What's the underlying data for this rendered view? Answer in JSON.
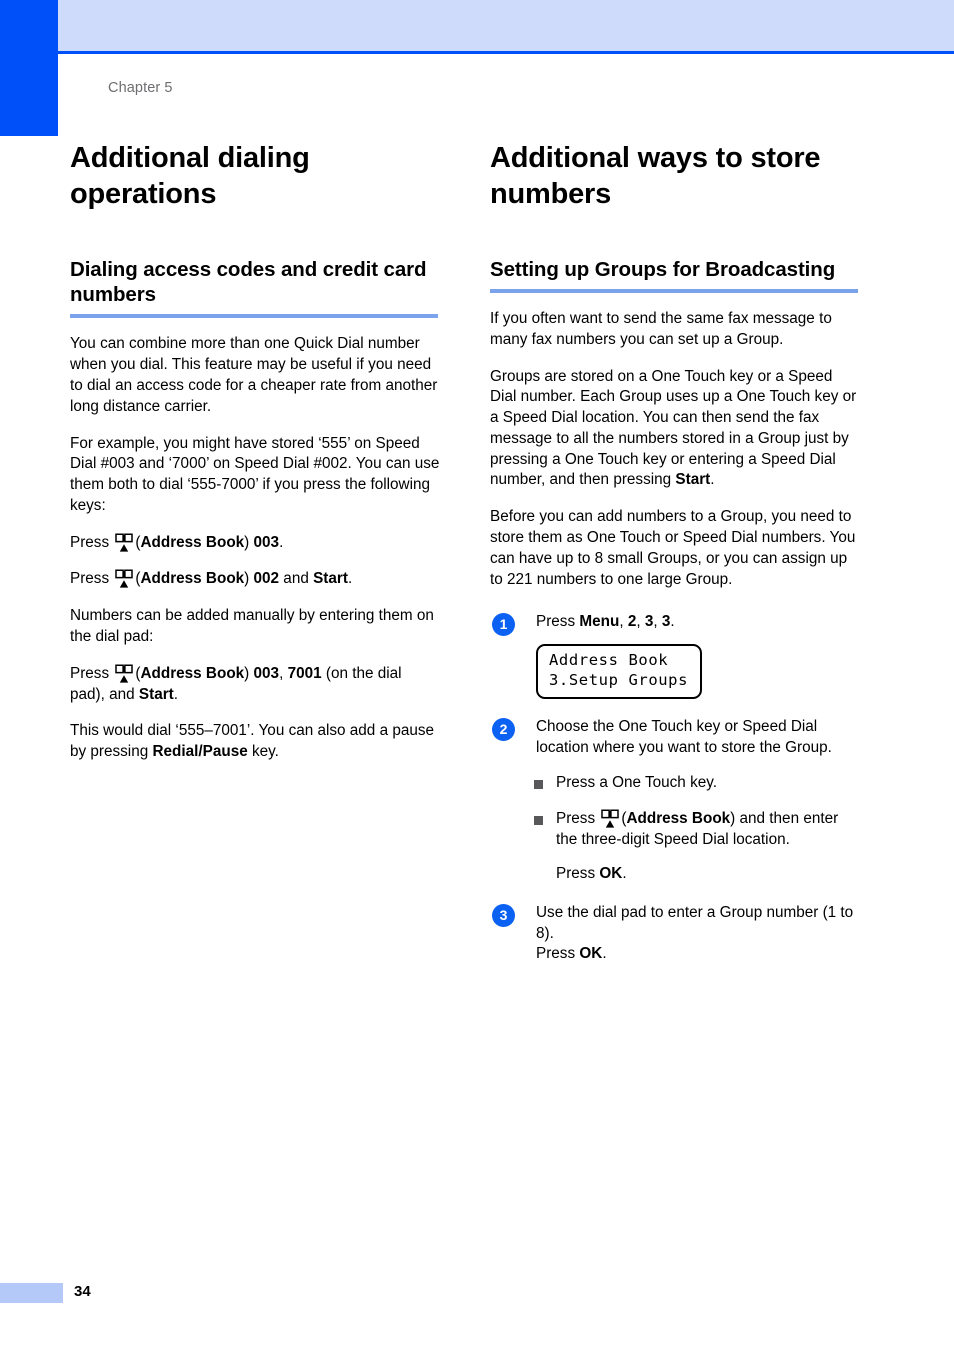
{
  "page": {
    "chapter_label": "Chapter 5",
    "page_number": "34",
    "accent_blue": "#0050fa",
    "band_blue": "#cedbfb",
    "rule_blue": "#7ba3ec",
    "footer_blue": "#b5c9f8",
    "step_circle_blue": "#0b61f2",
    "bullet_gray": "#58585b"
  },
  "left_column": {
    "chapter_title": "Additional dialing operations",
    "section_title": "Dialing access codes and credit card numbers",
    "paragraphs": {
      "p1": "You can combine more than one Quick Dial number when you dial. This feature may be useful if you need to dial an access code for a cheaper rate from another long distance carrier.",
      "p2": "For example, you might have stored ‘555’ on Speed Dial #003 and ‘7000’ on Speed Dial #002. You can use them both to dial ‘555-7000’ if you press the following keys:",
      "press1_pre": "Press ",
      "press1_open": "(",
      "press1_label": "Address Book",
      "press1_close": ") ",
      "press1_code": "003",
      "press1_end": ".",
      "press2_pre": "Press ",
      "press2_open": "(",
      "press2_label": "Address Book",
      "press2_close": ") ",
      "press2_code": "002",
      "press2_mid": " and ",
      "press2_key": "Start",
      "press2_end": ".",
      "p3": "Numbers can be added manually by entering them on the dial pad:",
      "press3_pre": "Press ",
      "press3_open": "(",
      "press3_label": "Address Book",
      "press3_close": ") ",
      "press3_code1": "003",
      "press3_comma": ", ",
      "press3_code2": "7001",
      "press3_mid": " (on the dial pad), and ",
      "press3_key": "Start",
      "press3_end": ".",
      "p4_pre": "This would dial ‘555–7001’. You can also add a pause by pressing ",
      "p4_key": "Redial/Pause",
      "p4_end": " key."
    }
  },
  "right_column": {
    "chapter_title": "Additional ways to store numbers",
    "section_title": "Setting up Groups for Broadcasting",
    "paragraphs": {
      "p1": "If you often want to send the same fax message to many fax numbers you can set up a Group.",
      "p2_pre": "Groups are stored on a One Touch key or a Speed Dial number. Each Group uses up a One Touch key or a Speed Dial location. You can then send the fax message to all the numbers stored in a Group just by pressing a One Touch key or entering a Speed Dial number, and then pressing ",
      "p2_key": "Start",
      "p2_end": ".",
      "p3": "Before you can add numbers to a Group, you need to store them as One Touch or Speed Dial numbers. You can have up to 8 small Groups, or you can assign up to 221 numbers to one large Group."
    },
    "steps": [
      {
        "number": "1",
        "text_pre": "Press ",
        "key1": "Menu",
        "sep1": ", ",
        "key2": "2",
        "sep2": ", ",
        "key3": "3",
        "sep3": ", ",
        "key4": "3",
        "text_end": "."
      },
      {
        "number": "2",
        "text": "Choose the One Touch key or Speed Dial location where you want to store the Group."
      },
      {
        "number": "3",
        "text_line1": "Use the dial pad to enter a Group number (1 to 8).",
        "text_line2_pre": "Press ",
        "text_line2_key": "OK",
        "text_line2_end": "."
      }
    ],
    "lcd": {
      "line1": "Address Book",
      "line2": "3.Setup Groups"
    },
    "bullets": [
      {
        "text": "Press a One Touch key."
      },
      {
        "text_pre": "Press ",
        "open": "(",
        "label": "Address Book",
        "close": ")",
        "text_end": " and then enter the three-digit Speed Dial location."
      }
    ],
    "bullet_sub": {
      "pre": "Press ",
      "key": "OK",
      "end": "."
    }
  },
  "icons": {
    "address_book": "address-book-icon"
  }
}
